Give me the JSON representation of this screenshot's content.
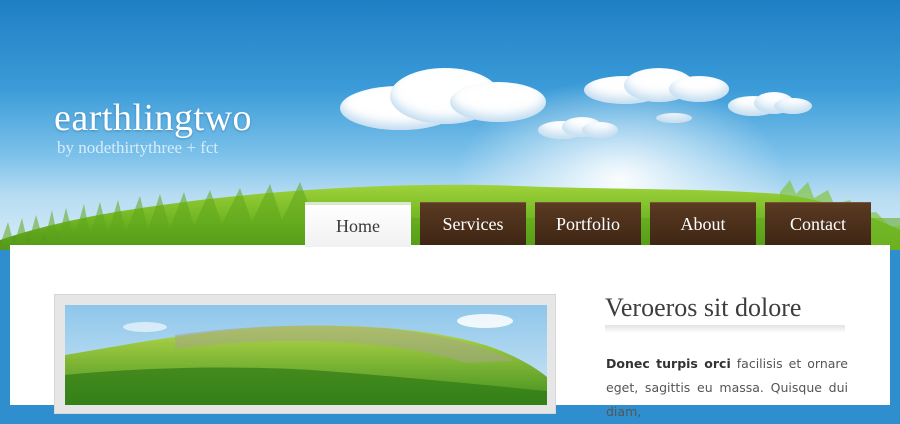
{
  "site": {
    "title": "earthlingtwo",
    "subtitle": "by nodethirtythree + fct"
  },
  "nav": {
    "items": [
      {
        "label": "Home",
        "active": true
      },
      {
        "label": "Services",
        "active": false
      },
      {
        "label": "Portfolio",
        "active": false
      },
      {
        "label": "About",
        "active": false
      },
      {
        "label": "Contact",
        "active": false
      }
    ]
  },
  "sidebar": {
    "heading": "Veroeros sit dolore",
    "lead_bold": "Donec turpis orci",
    "lead_text": " facilisis et ornare eget, sagittis eu massa. Quisque dui diam,"
  },
  "colors": {
    "sky_top": "#1f7fc4",
    "nav_brown": "#4a2f1a",
    "grass_green": "#6db322"
  }
}
